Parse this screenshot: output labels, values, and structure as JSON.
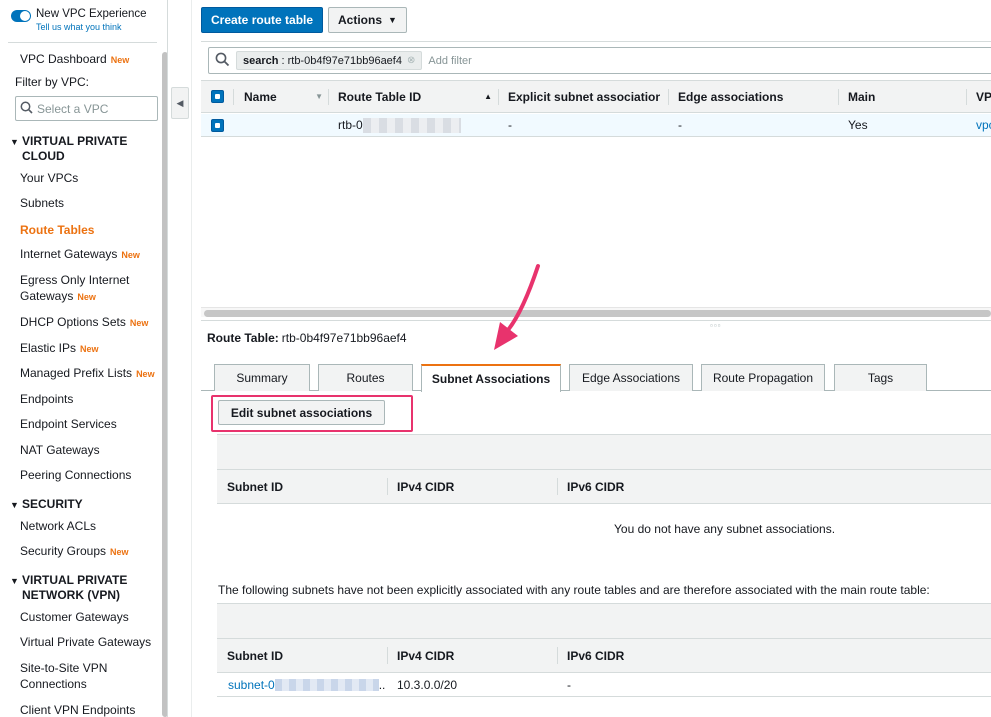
{
  "sidebar": {
    "toggle_title": "New VPC Experience",
    "toggle_link": "Tell us what you think",
    "dashboard": "VPC Dashboard",
    "new_label": "New",
    "filter_label": "Filter by VPC:",
    "filter_placeholder": "Select a VPC",
    "sections": {
      "vpc": "VIRTUAL PRIVATE CLOUD",
      "security": "SECURITY",
      "vpn": "VIRTUAL PRIVATE NETWORK (VPN)"
    },
    "items": {
      "your_vpcs": "Your VPCs",
      "subnets": "Subnets",
      "route_tables": "Route Tables",
      "internet_gateways": "Internet Gateways",
      "egress_only_1": "Egress Only Internet",
      "egress_only_2": "Gateways",
      "dhcp": "DHCP Options Sets",
      "elastic_ips": "Elastic IPs",
      "prefix_lists": "Managed Prefix Lists",
      "endpoints": "Endpoints",
      "endpoint_services": "Endpoint Services",
      "nat_gateways": "NAT Gateways",
      "peering": "Peering Connections",
      "network_acls": "Network ACLs",
      "security_groups": "Security Groups",
      "customer_gateways": "Customer Gateways",
      "vpg": "Virtual Private Gateways",
      "s2s_1": "Site-to-Site VPN",
      "s2s_2": "Connections",
      "client_vpn": "Client VPN Endpoints"
    }
  },
  "toolbar": {
    "create_label": "Create route table",
    "actions_label": "Actions"
  },
  "filter": {
    "token_key": "search",
    "token_value": ": rtb-0b4f97e71bb96aef4",
    "add_filter": "Add filter"
  },
  "grid": {
    "columns": [
      "Name",
      "Route Table ID",
      "Explicit subnet association",
      "Edge associations",
      "Main",
      "VPC"
    ],
    "row": {
      "route_table_id_prefix": "rtb-0",
      "explicit": "-",
      "edge": "-",
      "main": "Yes",
      "vpc": "vpc"
    }
  },
  "detail": {
    "title_label": "Route Table:",
    "title_value": "rtb-0b4f97e71bb96aef4",
    "tabs": [
      "Summary",
      "Routes",
      "Subnet Associations",
      "Edge Associations",
      "Route Propagation",
      "Tags"
    ],
    "active_tab": "Subnet Associations",
    "edit_button": "Edit subnet associations",
    "sub_columns": [
      "Subnet ID",
      "IPv4 CIDR",
      "IPv6 CIDR"
    ],
    "empty_message": "You do not have any subnet associations.",
    "info_text": "The following subnets have not been explicitly associated with any route tables and are therefore associated with the main route table:",
    "subnet_row": {
      "subnet_prefix": "subnet-0",
      "ellipsis": "..",
      "ipv4": "10.3.0.0/20",
      "ipv6": "-"
    }
  },
  "colors": {
    "primary": "#0073bb",
    "accent_orange": "#ec7211",
    "annotation": "#e8336d"
  }
}
